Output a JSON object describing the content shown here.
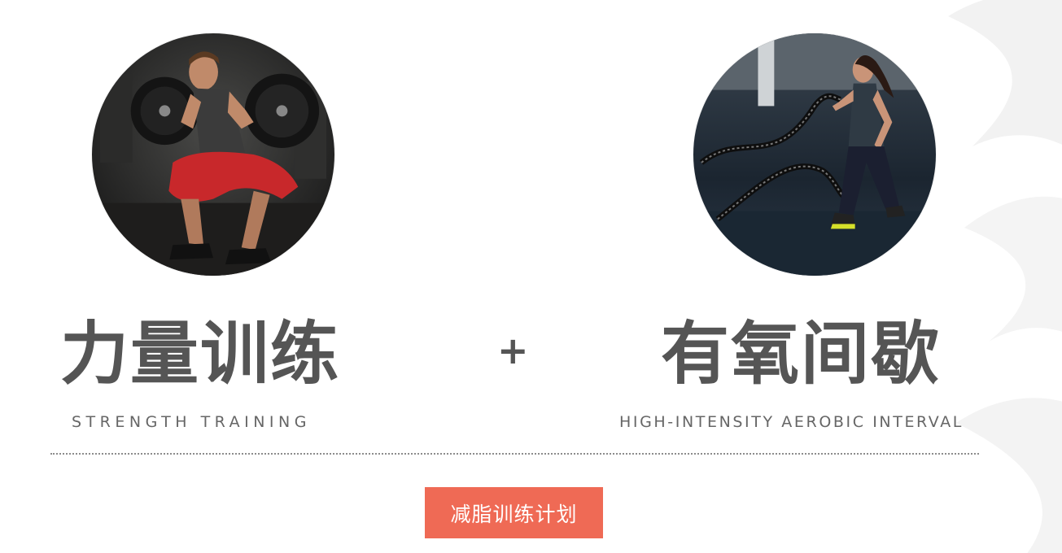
{
  "left": {
    "title": "力量训练",
    "subtitle": "STRENGTH TRAINING"
  },
  "right": {
    "title": "有氧间歇",
    "subtitle": "HIGH-INTENSITY AEROBIC INTERVAL"
  },
  "plus_symbol": "+",
  "cta": {
    "label": "减脂训练计划"
  },
  "colors": {
    "title_text": "#555555",
    "subtitle_text": "#666666",
    "cta_background": "#ef6a55",
    "divider": "#8c8c8c"
  }
}
